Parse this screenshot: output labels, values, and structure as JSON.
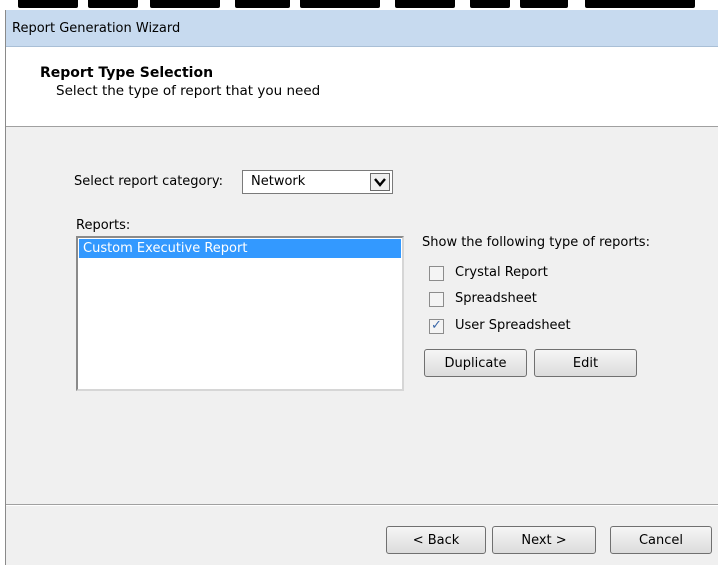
{
  "window": {
    "title": "Report Generation Wizard"
  },
  "header": {
    "title": "Report Type Selection",
    "subtitle": "Select the type of report that you need"
  },
  "category": {
    "label": "Select report category:",
    "selected": "Network"
  },
  "reports": {
    "label": "Reports:",
    "items": [
      {
        "label": "Custom Executive Report",
        "selected": true
      }
    ]
  },
  "filters": {
    "label": "Show the following type of reports:",
    "options": [
      {
        "label": "Crystal Report",
        "checked": false
      },
      {
        "label": "Spreadsheet",
        "checked": false
      },
      {
        "label": "User Spreadsheet",
        "checked": true
      }
    ]
  },
  "actions": {
    "duplicate": "Duplicate",
    "edit": "Edit"
  },
  "footer": {
    "back": "< Back",
    "next": "Next >",
    "cancel": "Cancel"
  }
}
